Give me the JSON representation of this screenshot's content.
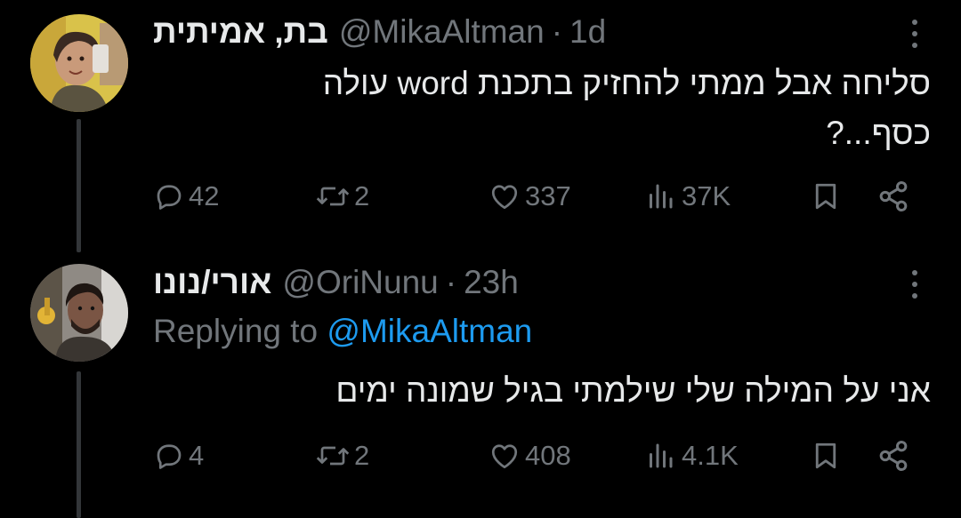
{
  "tweets": [
    {
      "display_name": "בת, אמיתית",
      "handle": "@MikaAltman",
      "separator": "·",
      "time": "1d",
      "text_line1": "סליחה אבל ממתי להחזיק בתכנת word עולה",
      "text_line2": "כסף...?",
      "replies": "42",
      "reposts": "2",
      "likes": "337",
      "views": "37K"
    },
    {
      "display_name": "אורי/נונו",
      "handle": "@OriNunu",
      "separator": "·",
      "time": "23h",
      "replying_prefix": "Replying to",
      "replying_to": "@MikaAltman",
      "text_line1": "אני על המילה שלי שילמתי בגיל שמונה ימים",
      "replies": "4",
      "reposts": "2",
      "likes": "408",
      "views": "4.1K"
    }
  ],
  "colors": {
    "background": "#000000",
    "text": "#e7e9ea",
    "muted": "#71767b",
    "link": "#1d9bf0",
    "thread_line": "#333639"
  },
  "icons": [
    "reply-icon",
    "repost-icon",
    "like-icon",
    "views-icon",
    "bookmark-icon",
    "share-icon",
    "more-icon"
  ]
}
